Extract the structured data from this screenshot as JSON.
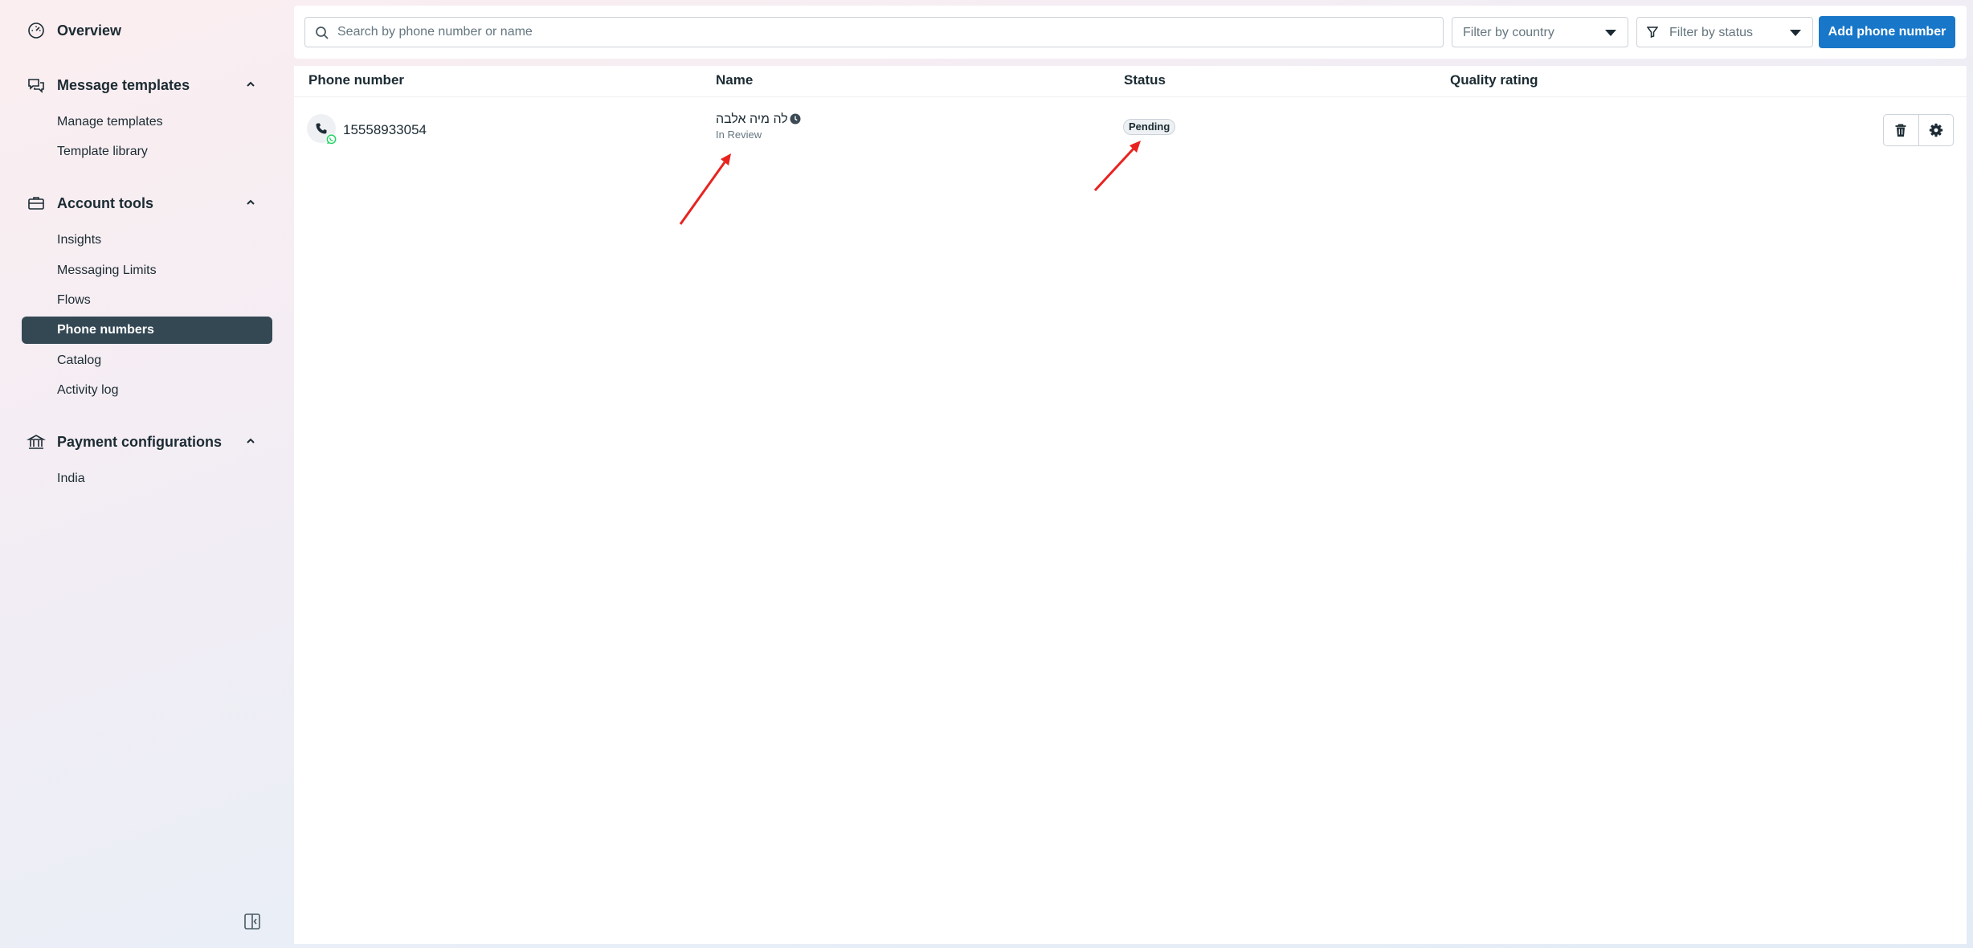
{
  "sidebar": {
    "overview": {
      "label": "Overview",
      "icon": "gauge-icon"
    },
    "sections": [
      {
        "label": "Message templates",
        "icon": "chat-bubbles-icon",
        "items": [
          {
            "label": "Manage templates"
          },
          {
            "label": "Template library"
          }
        ]
      },
      {
        "label": "Account tools",
        "icon": "briefcase-icon",
        "items": [
          {
            "label": "Insights"
          },
          {
            "label": "Messaging Limits"
          },
          {
            "label": "Flows"
          },
          {
            "label": "Phone numbers",
            "active": true
          },
          {
            "label": "Catalog"
          },
          {
            "label": "Activity log"
          }
        ]
      },
      {
        "label": "Payment configurations",
        "icon": "bank-icon",
        "items": [
          {
            "label": "India"
          }
        ]
      }
    ],
    "active_color": "#344854"
  },
  "toolbar": {
    "search_placeholder": "Search by phone number or name",
    "country_filter": "Filter by country",
    "status_filter": "Filter by status",
    "add_button": "Add phone number",
    "accent_color": "#1877c9"
  },
  "table": {
    "columns": [
      "Phone number",
      "Name",
      "Status",
      "Quality rating"
    ],
    "rows": [
      {
        "phone": "15558933054",
        "name": "לה מיה אלבה",
        "name_status": "In Review",
        "status": "Pending",
        "quality_rating": ""
      }
    ]
  },
  "annotations": {
    "arrow_color": "#e8231f",
    "count": 2
  }
}
